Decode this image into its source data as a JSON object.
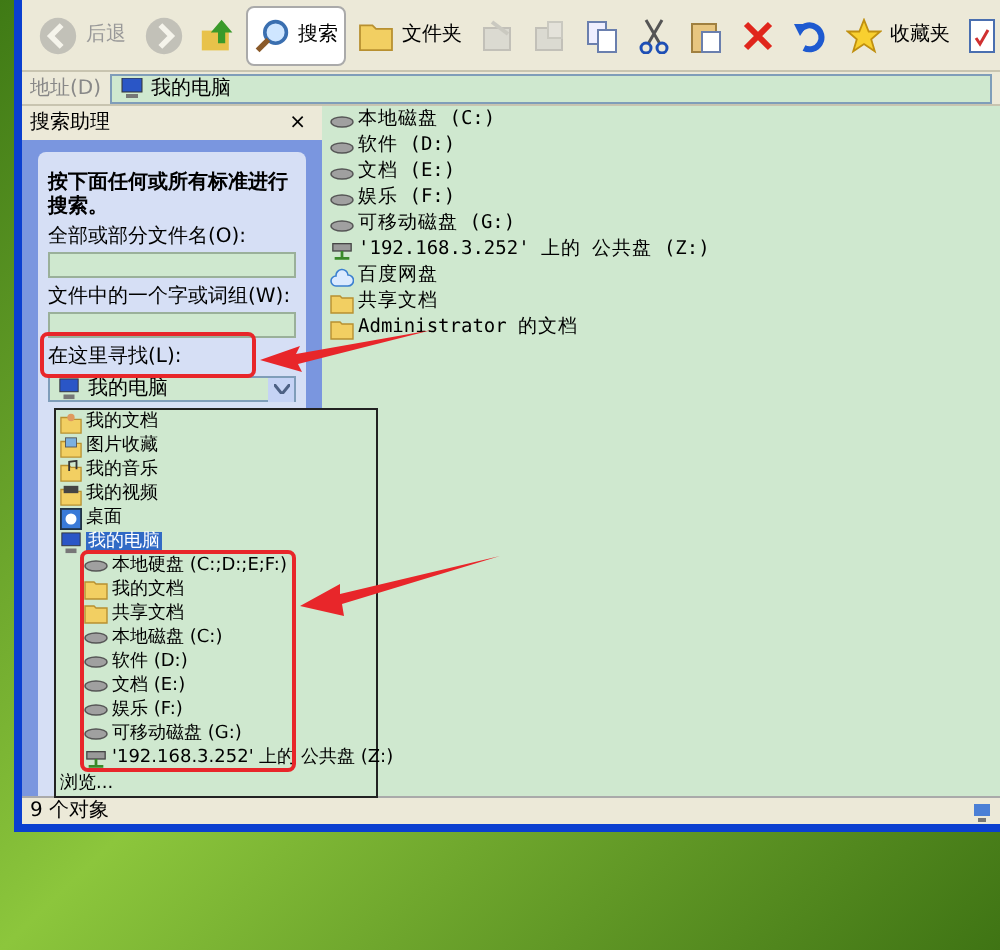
{
  "toolbar": {
    "buttons": [
      {
        "kind": "back",
        "label": "后退",
        "disabled": true
      },
      {
        "kind": "forward",
        "disabled": true
      },
      {
        "kind": "up"
      },
      {
        "kind": "search",
        "label": "搜索",
        "selected": true
      },
      {
        "kind": "folders",
        "label": "文件夹",
        "selected": false
      },
      {
        "kind": "moveto",
        "disabled": true
      },
      {
        "kind": "copyto",
        "disabled": true
      },
      {
        "kind": "copy"
      },
      {
        "kind": "cut"
      },
      {
        "kind": "paste"
      },
      {
        "kind": "delete"
      },
      {
        "kind": "undo"
      },
      {
        "kind": "favorites",
        "label": "收藏夹"
      },
      {
        "kind": "page"
      }
    ]
  },
  "address_bar": {
    "label": "地址(D)",
    "value": "我的电脑"
  },
  "search_pane": {
    "title": "搜索助理",
    "close": "×",
    "intro": "按下面任何或所有标准进行搜索。",
    "fields": [
      {
        "label": "全部或部分文件名(O):"
      },
      {
        "label": "文件中的一个字或词组(W):"
      }
    ],
    "look_in": {
      "label": "在这里寻找(L):",
      "value": "我的电脑"
    }
  },
  "look_in_dropdown": {
    "items": [
      {
        "label": "我的文档",
        "kind": "docs",
        "selected": false
      },
      {
        "label": "图片收藏",
        "kind": "pictures",
        "selected": false
      },
      {
        "label": "我的音乐",
        "kind": "music",
        "selected": false
      },
      {
        "label": "我的视频",
        "kind": "video",
        "selected": false
      },
      {
        "label": "桌面",
        "kind": "desktop",
        "selected": false
      },
      {
        "label": "我的电脑",
        "kind": "computer",
        "selected": true,
        "children": [
          {
            "label": "本地硬盘 (C:;D:;E;F:)",
            "kind": "drive",
            "selected": false
          },
          {
            "label": "我的文档",
            "kind": "folder",
            "selected": false
          },
          {
            "label": "共享文档",
            "kind": "folder",
            "selected": false
          },
          {
            "label": "本地磁盘 (C:)",
            "kind": "drive",
            "selected": false
          },
          {
            "label": "软件 (D:)",
            "kind": "drive",
            "selected": false
          },
          {
            "label": "文档 (E:)",
            "kind": "drive",
            "selected": false
          },
          {
            "label": "娱乐 (F:)",
            "kind": "drive",
            "selected": false
          },
          {
            "label": "可移动磁盘 (G:)",
            "kind": "drive",
            "selected": false
          },
          {
            "label": "'192.168.3.252' 上的 公共盘 (Z:)",
            "kind": "netdrive",
            "selected": false
          }
        ]
      }
    ],
    "browse": "浏览..."
  },
  "files": [
    {
      "name": "本地磁盘 (C:)",
      "kind": "drive"
    },
    {
      "name": "软件 (D:)",
      "kind": "drive"
    },
    {
      "name": "文档 (E:)",
      "kind": "drive"
    },
    {
      "name": "娱乐 (F:)",
      "kind": "drive"
    },
    {
      "name": "可移动磁盘 (G:)",
      "kind": "drive"
    },
    {
      "name": "'192.168.3.252' 上的 公共盘 (Z:)",
      "kind": "netdrive"
    },
    {
      "name": "百度网盘",
      "kind": "cloud"
    },
    {
      "name": "共享文档",
      "kind": "folder"
    },
    {
      "name": "Administrator 的文档",
      "kind": "folder"
    }
  ],
  "status_bar": {
    "text": "9 个对象"
  }
}
